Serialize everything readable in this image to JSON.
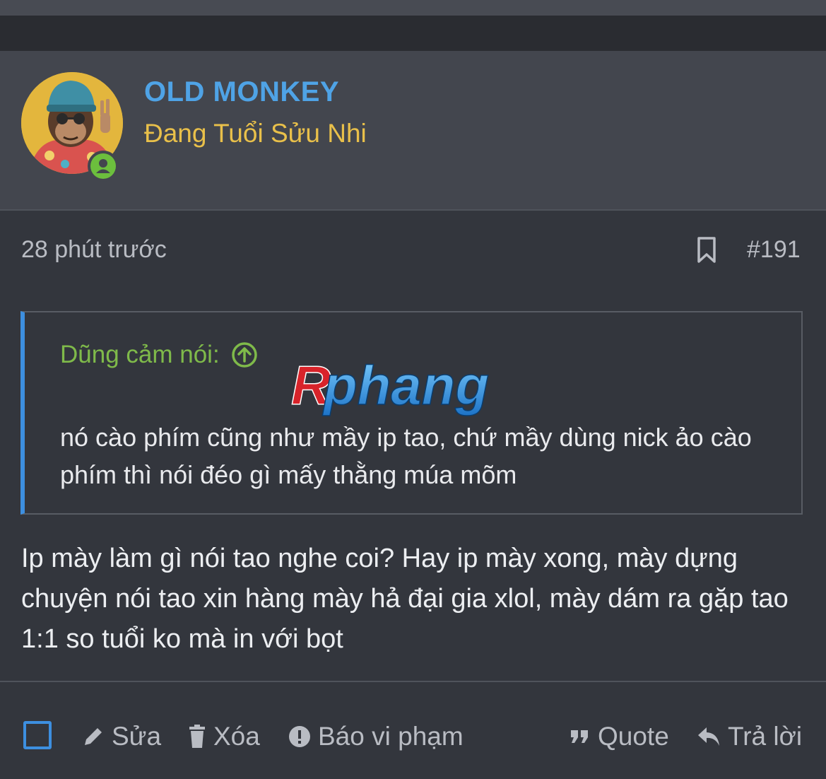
{
  "user": {
    "username": "OLD MONKEY",
    "title": "Đang Tuổi Sửu Nhi"
  },
  "post": {
    "time": "28 phút trước",
    "number": "#191",
    "quote": {
      "author": "Dũng cảm nói:",
      "text": "nó cào phím cũng như mầy ip tao, chứ mầy dùng nick ảo cào phím thì nói đéo gì mấy thằng múa mõm"
    },
    "body": "Ip mày làm gì nói tao nghe coi? Hay ip mày xong, mày dựng chuyện nói tao xin hàng mày hả đại gia xlol, mày dám ra gặp tao 1:1 so tuổi ko mà in với bọt"
  },
  "watermark": {
    "text": "Rphang"
  },
  "actions": {
    "edit": "Sửa",
    "delete": "Xóa",
    "report": "Báo vi phạm",
    "quote": "Quote",
    "reply": "Trả lời"
  },
  "colors": {
    "username": "#4fa3e6",
    "title": "#e9c04a",
    "quote_author": "#7fba4a",
    "accent": "#3d8fe0",
    "online": "#6cbf3d"
  },
  "icons": [
    "bookmark-icon",
    "arrow-up-circle-icon",
    "user-online-icon",
    "pencil-icon",
    "trash-icon",
    "exclamation-circle-icon",
    "quote-icon",
    "reply-icon"
  ]
}
